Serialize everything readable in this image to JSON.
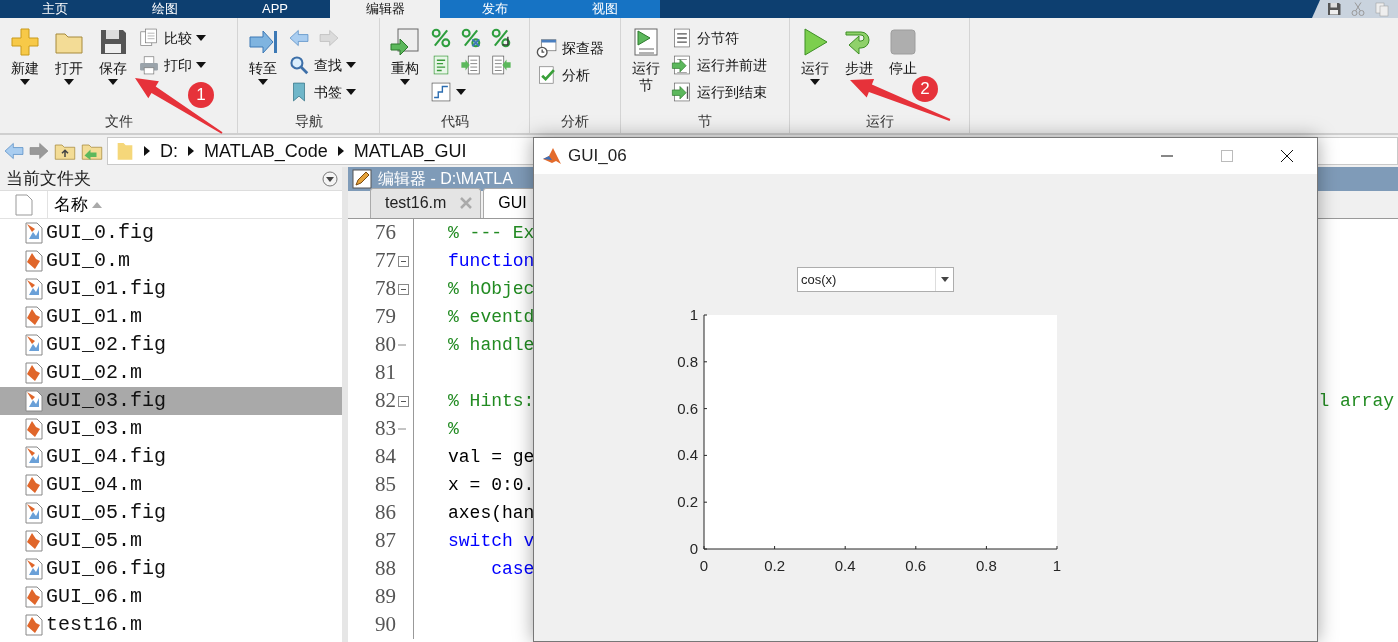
{
  "ribbon_tabs": [
    {
      "label": "主页",
      "selected": false,
      "kind": "main"
    },
    {
      "label": "绘图",
      "selected": false,
      "kind": "main"
    },
    {
      "label": "APP",
      "selected": false,
      "kind": "main"
    },
    {
      "label": "编辑器",
      "selected": true,
      "kind": "context"
    },
    {
      "label": "发布",
      "selected": false,
      "kind": "context"
    },
    {
      "label": "视图",
      "selected": false,
      "kind": "context"
    }
  ],
  "ribbon_groups": [
    {
      "label": "文件",
      "columns": [
        {
          "kind": "large",
          "label": "新建",
          "dropdown": true,
          "disabled": false
        },
        {
          "kind": "large",
          "label": "打开",
          "dropdown": true,
          "disabled": false
        },
        {
          "kind": "large",
          "label": "保存",
          "dropdown": true,
          "disabled": false
        },
        {
          "kind": "stack",
          "rows": [
            [
              {
                "label": "比较",
                "dropdown": true,
                "disabled": false
              }
            ],
            [
              {
                "label": "打印",
                "dropdown": true,
                "disabled": false
              }
            ]
          ]
        }
      ]
    },
    {
      "label": "导航",
      "columns": [
        {
          "kind": "large",
          "label": "转至",
          "dropdown": true,
          "disabled": false
        },
        {
          "kind": "stack",
          "rows": [
            [
              {
                "dropdown": false,
                "disabled": false
              },
              {
                "dropdown": false,
                "disabled": true
              }
            ],
            [
              {
                "label": "查找",
                "dropdown": true,
                "disabled": false
              }
            ],
            [
              {
                "label": "书签",
                "dropdown": true,
                "disabled": false
              }
            ]
          ]
        }
      ]
    },
    {
      "label": "代码",
      "columns": [
        {
          "kind": "large",
          "label": "重构",
          "dropdown": true,
          "disabled": false
        },
        {
          "kind": "stack",
          "rows": [
            [
              {
                "dropdown": false,
                "disabled": false
              },
              {
                "dropdown": false,
                "disabled": false
              },
              {
                "dropdown": false,
                "disabled": false
              }
            ],
            [
              {
                "dropdown": false,
                "disabled": false
              },
              {
                "dropdown": false,
                "disabled": false
              },
              {
                "dropdown": false,
                "disabled": false
              }
            ],
            [
              {
                "dropdown": true,
                "disabled": false
              }
            ]
          ]
        }
      ]
    },
    {
      "label": "分析",
      "columns": [
        {
          "kind": "stack",
          "rows": [
            [
              {
                "label": "探查器",
                "dropdown": false,
                "disabled": false
              }
            ],
            [
              {
                "label": "分析",
                "dropdown": false,
                "disabled": false
              }
            ]
          ]
        }
      ]
    },
    {
      "label": "节",
      "columns": [
        {
          "kind": "large",
          "label": "运行节",
          "dropdown": false,
          "disabled": false
        },
        {
          "kind": "stack",
          "rows": [
            [
              {
                "label": "分节符",
                "dropdown": false,
                "disabled": false
              }
            ],
            [
              {
                "label": "运行并前进",
                "dropdown": false,
                "disabled": false
              }
            ],
            [
              {
                "label": "运行到结束",
                "dropdown": false,
                "disabled": false
              }
            ]
          ]
        }
      ]
    },
    {
      "label": "运行",
      "columns": [
        {
          "kind": "large",
          "label": "运行",
          "dropdown": true,
          "disabled": false
        },
        {
          "kind": "large",
          "label": "步进",
          "dropdown": false,
          "disabled": false
        },
        {
          "kind": "large",
          "label": "停止",
          "dropdown": false,
          "disabled": true
        }
      ]
    }
  ],
  "annotations": [
    {
      "label": "1"
    },
    {
      "label": "2"
    }
  ],
  "address_bar": {
    "segments": [
      "D:",
      "MATLAB_Code",
      "MATLAB_GUI"
    ]
  },
  "file_browser": {
    "title": "当前文件夹",
    "column": "名称",
    "files": [
      {
        "name": "GUI_0.fig",
        "kind": "fig",
        "selected": false
      },
      {
        "name": "GUI_0.m",
        "kind": "m",
        "selected": false
      },
      {
        "name": "GUI_01.fig",
        "kind": "fig",
        "selected": false
      },
      {
        "name": "GUI_01.m",
        "kind": "m",
        "selected": false
      },
      {
        "name": "GUI_02.fig",
        "kind": "fig",
        "selected": false
      },
      {
        "name": "GUI_02.m",
        "kind": "m",
        "selected": false
      },
      {
        "name": "GUI_03.fig",
        "kind": "fig",
        "selected": true
      },
      {
        "name": "GUI_03.m",
        "kind": "m",
        "selected": false
      },
      {
        "name": "GUI_04.fig",
        "kind": "fig",
        "selected": false
      },
      {
        "name": "GUI_04.m",
        "kind": "m",
        "selected": false
      },
      {
        "name": "GUI_05.fig",
        "kind": "fig",
        "selected": false
      },
      {
        "name": "GUI_05.m",
        "kind": "m",
        "selected": false
      },
      {
        "name": "GUI_06.fig",
        "kind": "fig",
        "selected": false
      },
      {
        "name": "GUI_06.m",
        "kind": "m",
        "selected": false
      },
      {
        "name": "test16.m",
        "kind": "m",
        "selected": false
      }
    ]
  },
  "editor": {
    "title": "编辑器 - D:\\MATLA",
    "tabs": [
      {
        "label": "test16.m",
        "selected": false,
        "closable": true
      },
      {
        "label": "GUI",
        "selected": true,
        "closable": false
      }
    ],
    "lines": [
      {
        "number": "76",
        "code": "% --- Ex",
        "kind": "comment",
        "fold_toggle": false,
        "fold_end": false
      },
      {
        "number": "77",
        "code": "function",
        "kind": "keyword",
        "fold_toggle": true,
        "fold_end": false
      },
      {
        "number": "78",
        "code": "% hObjec",
        "kind": "comment",
        "fold_toggle": true,
        "fold_end": false
      },
      {
        "number": "79",
        "code": "% eventd",
        "kind": "comment",
        "fold_toggle": false,
        "fold_end": false
      },
      {
        "number": "80",
        "code": "% handle",
        "kind": "comment",
        "fold_toggle": false,
        "fold_end": true
      },
      {
        "number": "81",
        "fold_toggle": false,
        "fold_end": false
      },
      {
        "number": "82",
        "code": "% Hints:",
        "kind": "comment",
        "fold_toggle": true,
        "fold_end": false,
        "tail": "l array"
      },
      {
        "number": "83",
        "code": "%",
        "kind": "comment",
        "fold_toggle": false,
        "fold_end": true
      },
      {
        "number": "84",
        "code": "val = ge",
        "kind": "plain",
        "fold_toggle": false,
        "fold_end": false
      },
      {
        "number": "85",
        "code": "x = 0:0.",
        "kind": "plain",
        "fold_toggle": false,
        "fold_end": false
      },
      {
        "number": "86",
        "code": "axes(han",
        "kind": "plain",
        "fold_toggle": false,
        "fold_end": false
      },
      {
        "number": "87",
        "code": "switch v",
        "kind": "keyword",
        "fold_toggle": false,
        "fold_end": false
      },
      {
        "number": "88",
        "code": "    case",
        "kind": "keyword",
        "fold_toggle": false,
        "fold_end": false
      },
      {
        "number": "89",
        "fold_toggle": false,
        "fold_end": false
      },
      {
        "number": "90",
        "fold_toggle": false,
        "fold_end": false
      }
    ]
  },
  "figure_window": {
    "title": "GUI_06",
    "popup": {
      "value": "cos(x)"
    },
    "chart_data": {
      "type": "line",
      "xlim": [
        0,
        1
      ],
      "ylim": [
        0,
        1
      ],
      "xticks": [
        0,
        0.2,
        0.4,
        0.6,
        0.8,
        1
      ],
      "yticks": [
        0,
        0.2,
        0.4,
        0.6,
        0.8,
        1
      ]
    }
  }
}
